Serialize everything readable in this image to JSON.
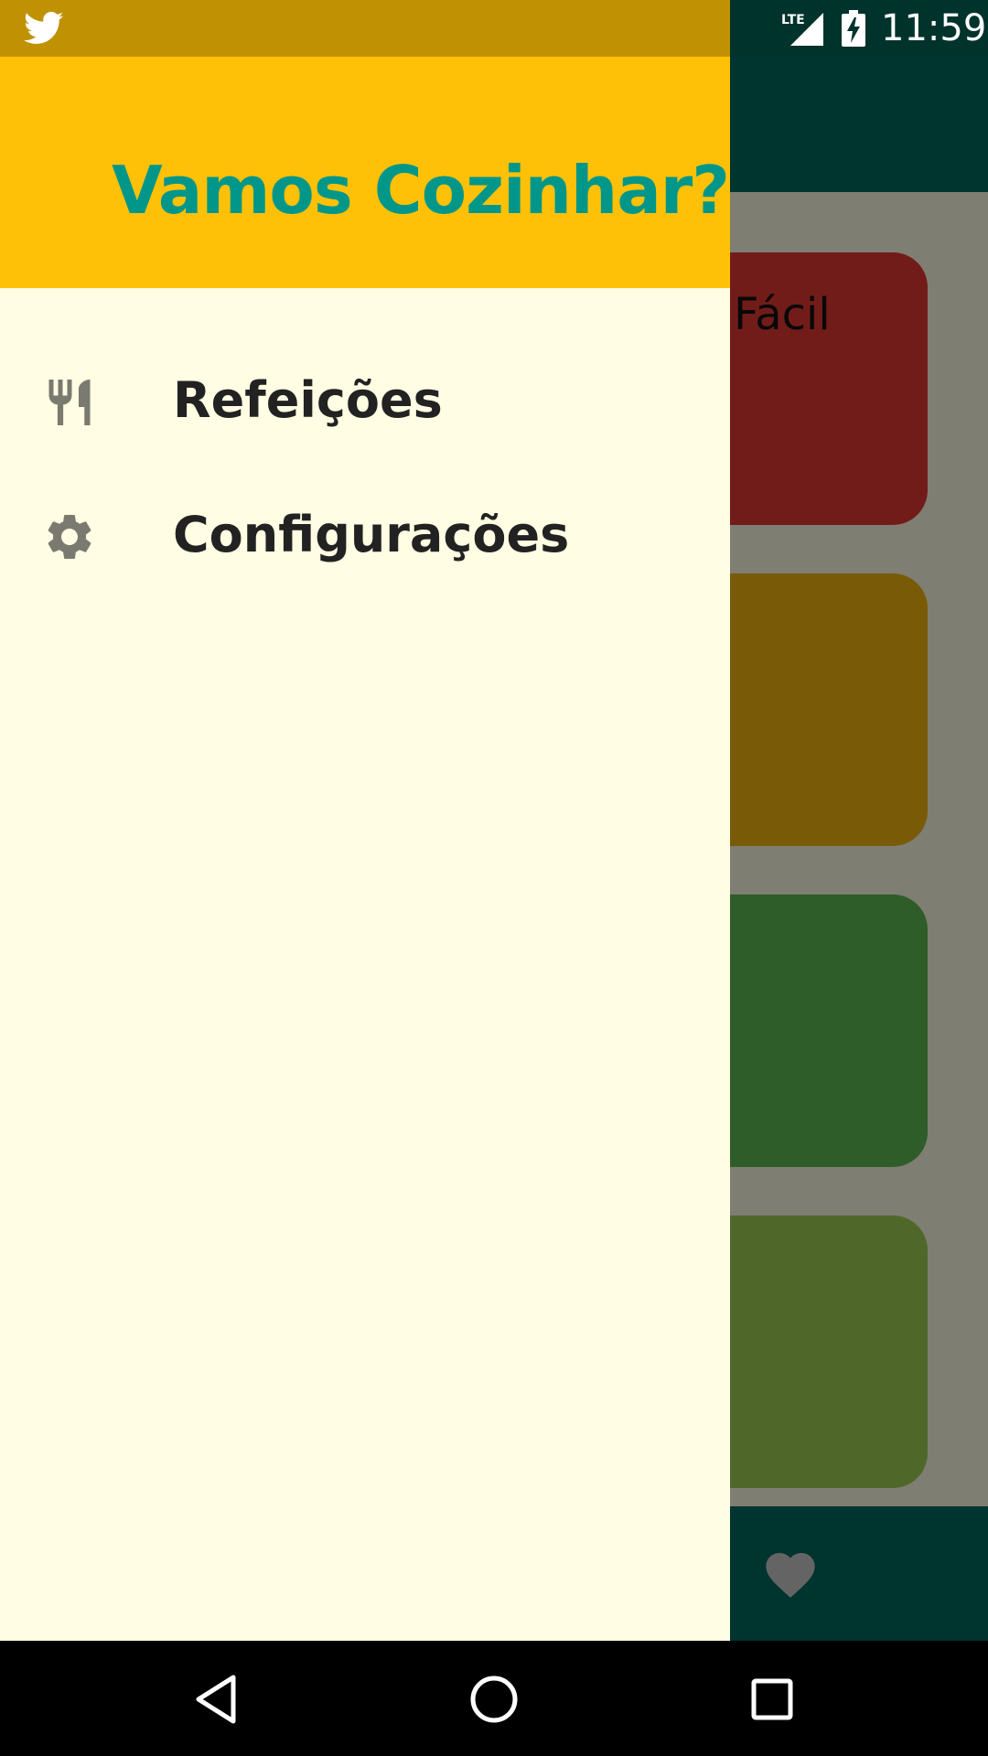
{
  "status_bar": {
    "time": "11:59",
    "network": "LTE",
    "notification_icon": "twitter-icon"
  },
  "drawer": {
    "title": "Vamos Cozinhar?",
    "items": [
      {
        "label": "Refeições",
        "icon": "fork-knife-icon"
      },
      {
        "label": "Configurações",
        "icon": "gear-icon"
      }
    ]
  },
  "background": {
    "cards": [
      {
        "label": "Fácil",
        "color": "#e53935"
      },
      {
        "label": "",
        "color": "#f2b70f"
      },
      {
        "label": "",
        "color": "#5fbb52"
      },
      {
        "label": "",
        "color": "#9ed154"
      }
    ],
    "bottom_icon": "heart-icon"
  },
  "nav_bar": {
    "buttons": [
      "back-icon",
      "home-icon",
      "recents-icon"
    ]
  },
  "colors": {
    "drawer_header": "#ffc107",
    "drawer_title": "#00978a",
    "drawer_background": "#fffde3",
    "toolbar": "#00695c"
  }
}
